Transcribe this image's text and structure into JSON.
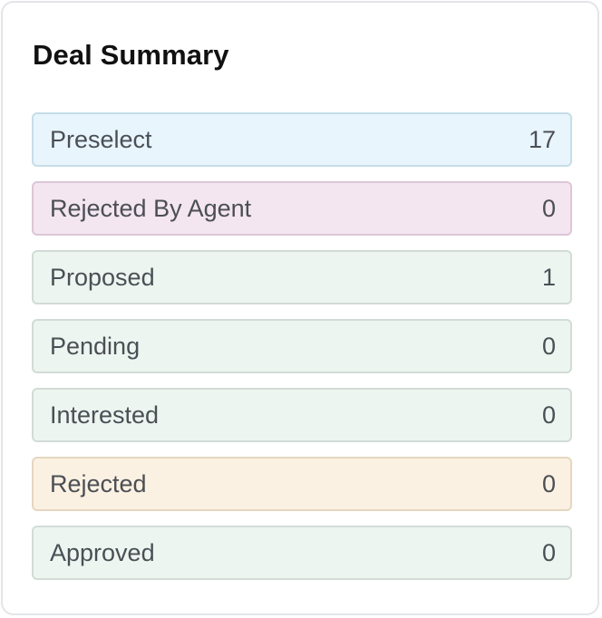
{
  "card": {
    "title": "Deal Summary"
  },
  "colors": {
    "preselect_bg": "#e8f5fd",
    "preselect_border": "#c6dde6",
    "rejected_by_agent_bg": "#f4e6f1",
    "rejected_by_agent_border": "#dcc6d6",
    "neutral_bg": "#edf5f0",
    "neutral_border": "#d2dcd6",
    "rejected_bg": "#fbf1e2",
    "rejected_border": "#e6d6c0",
    "text": "#4b4f55",
    "title": "#111111"
  },
  "statuses": [
    {
      "label": "Preselect",
      "count": "17",
      "tone": "preselect"
    },
    {
      "label": "Rejected By Agent",
      "count": "0",
      "tone": "rejected_by_agent"
    },
    {
      "label": "Proposed",
      "count": "1",
      "tone": "neutral"
    },
    {
      "label": "Pending",
      "count": "0",
      "tone": "neutral"
    },
    {
      "label": "Interested",
      "count": "0",
      "tone": "neutral"
    },
    {
      "label": "Rejected",
      "count": "0",
      "tone": "rejected"
    },
    {
      "label": "Approved",
      "count": "0",
      "tone": "neutral"
    }
  ]
}
